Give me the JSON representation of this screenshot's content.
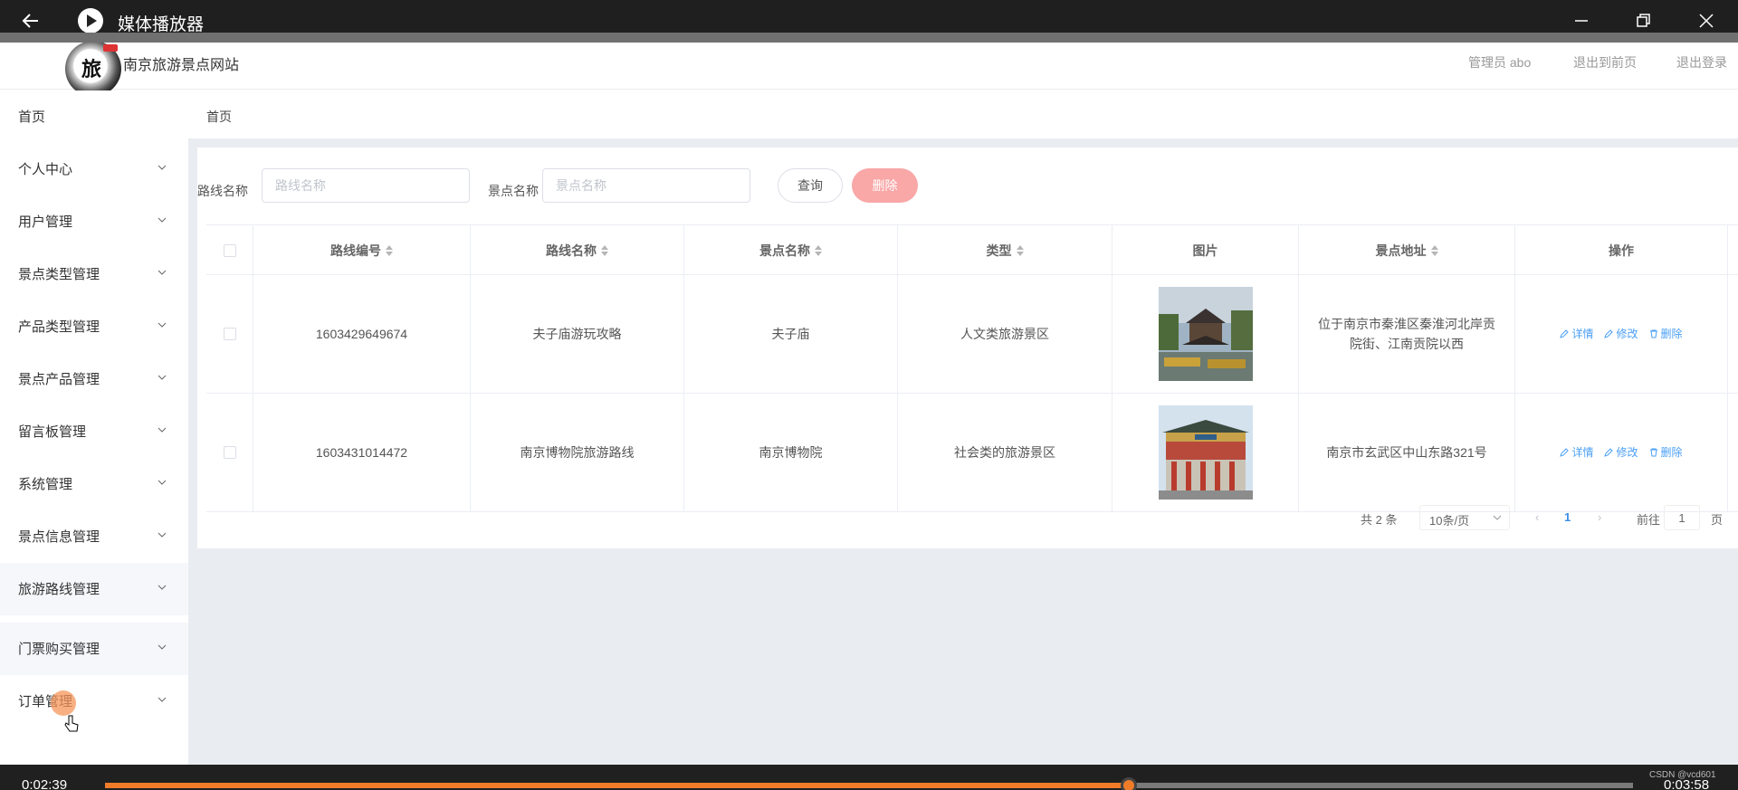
{
  "player": {
    "title": "媒体播放器",
    "time_current": "0:02:39",
    "time_total": "0:03:58",
    "progress_fraction": 0.67,
    "watermark": "CSDN @vcd601",
    "accent": "#f07c2a"
  },
  "site": {
    "name": "南京旅游景点网站",
    "logo_char": "旅",
    "header_links": [
      "管理员 abo",
      "退出到前页",
      "退出登录"
    ]
  },
  "sidebar": {
    "items": [
      {
        "label": "首页",
        "has_arrow": false
      },
      {
        "label": "个人中心",
        "has_arrow": true
      },
      {
        "label": "用户管理",
        "has_arrow": true
      },
      {
        "label": "景点类型管理",
        "has_arrow": true
      },
      {
        "label": "产品类型管理",
        "has_arrow": true
      },
      {
        "label": "景点产品管理",
        "has_arrow": true
      },
      {
        "label": "留言板管理",
        "has_arrow": true
      },
      {
        "label": "系统管理",
        "has_arrow": true
      },
      {
        "label": "景点信息管理",
        "has_arrow": true
      },
      {
        "label": "旅游路线管理",
        "has_arrow": true
      },
      {
        "label": "门票购买管理",
        "has_arrow": true
      },
      {
        "label": "订单管理",
        "has_arrow": true
      }
    ]
  },
  "breadcrumb": "首页",
  "filters": {
    "route_label": "路线名称",
    "route_placeholder": "路线名称",
    "spot_label": "景点名称",
    "spot_placeholder": "景点名称",
    "query_button": "查询",
    "delete_button": "删除"
  },
  "table": {
    "columns": [
      "路线编号",
      "路线名称",
      "景点名称",
      "类型",
      "图片",
      "景点地址",
      "操作"
    ],
    "rows": [
      {
        "id": "1603429649674",
        "route": "夫子庙游玩攻略",
        "spot": "夫子庙",
        "type": "人文类旅游景区",
        "address": "位于南京市秦淮区秦淮河北岸贡院街、江南贡院以西"
      },
      {
        "id": "1603431014472",
        "route": "南京博物院旅游路线",
        "spot": "南京博物院",
        "type": "社会类的旅游景区",
        "address": "南京市玄武区中山东路321号"
      }
    ],
    "actions": [
      "详情",
      "修改",
      "删除"
    ]
  },
  "pagination": {
    "total": "共 2 条",
    "page_size": "10条/页",
    "current_page": "1",
    "goto_label": "前往",
    "goto_value": "1",
    "page_unit": "页"
  }
}
